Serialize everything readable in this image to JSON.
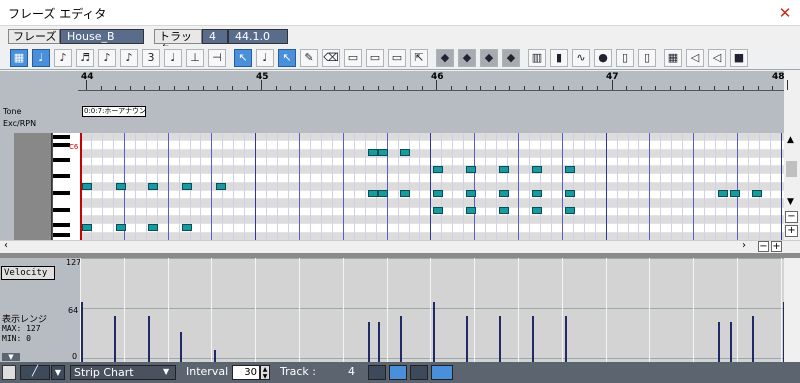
{
  "window": {
    "title": "フレーズ エディタ",
    "close_glyph": "✕"
  },
  "header": {
    "phrase_label": "フレーズ",
    "phrase_value": "House_B",
    "track_label": "トラック",
    "track_value": "4",
    "position_value": "44.1.0"
  },
  "toolbar": {
    "icons": [
      "grid-icon",
      "note-icon",
      "eighth-note-icon",
      "sixteenth-note-icon",
      "note-icon",
      "note-icon",
      "triplet-icon",
      "dotted-note-icon",
      "quantize-icon",
      "quantize-icon",
      "pointer-icon",
      "note-icon",
      "pointer-icon",
      "pencil-icon",
      "eraser-icon",
      "select-icon",
      "select-icon",
      "select-icon",
      "cursor-icon",
      "tool-icon",
      "tool-icon",
      "tool-icon",
      "tool-icon",
      "keyboard-icon",
      "velocity-icon",
      "wave-icon",
      "record-icon",
      "meter-icon",
      "meter-icon",
      "piano-icon",
      "speaker-icon",
      "speaker-icon",
      "stop-icon"
    ]
  },
  "ruler": {
    "bars": [
      "44",
      "45",
      "46",
      "47",
      "48"
    ]
  },
  "tracks": {
    "tone_label": "Tone",
    "exc_label": "Exc/RPN",
    "tone_value": "0:0:7:ホーアナウンド"
  },
  "piano": {
    "c6_label": "C6"
  },
  "velocity": {
    "header": "Velocity",
    "max_label": "127",
    "mid_label": "64",
    "min_label": "0",
    "range_label": "表示レンジ",
    "max_text": "MAX: 127",
    "min_text": "MIN:   0"
  },
  "bottom": {
    "chart_type": "Strip Chart",
    "interval_label": "Interval",
    "interval_value": "30",
    "track_label": "Track :",
    "track_value": "4"
  }
}
